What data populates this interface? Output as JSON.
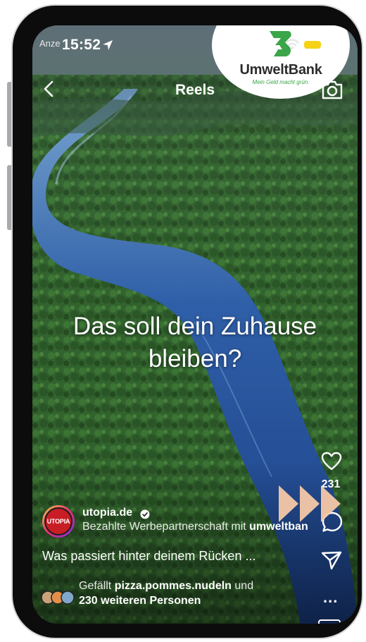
{
  "status_bar": {
    "prefix": "Anze",
    "time": "15:52"
  },
  "ad_badge": {
    "brand": "UmweltBank",
    "slogan": "Mein Geld macht grün."
  },
  "header": {
    "title": "Reels"
  },
  "video": {
    "headline": "Das soll dein Zuhause bleiben?"
  },
  "actions": {
    "like_count": "231",
    "more": "..."
  },
  "post": {
    "account": "utopia.de",
    "avatar_text": "UTOPIA",
    "sponsor_prefix": "Bezahlte Werbepartnerschaft mit",
    "sponsor_name": "umweltban",
    "caption": "Was passiert hinter deinem Rücken ...",
    "likes_prefix": "Gefällt",
    "likes_user": "pizza.pommes.nudeln",
    "likes_and": "und",
    "likes_others": "230 weiteren Personen"
  },
  "colors": {
    "accent_green": "#3aa549",
    "battery": "#f5d216",
    "brand_red": "#c81d25",
    "ffwd_overlay": "#f6c8a6"
  }
}
